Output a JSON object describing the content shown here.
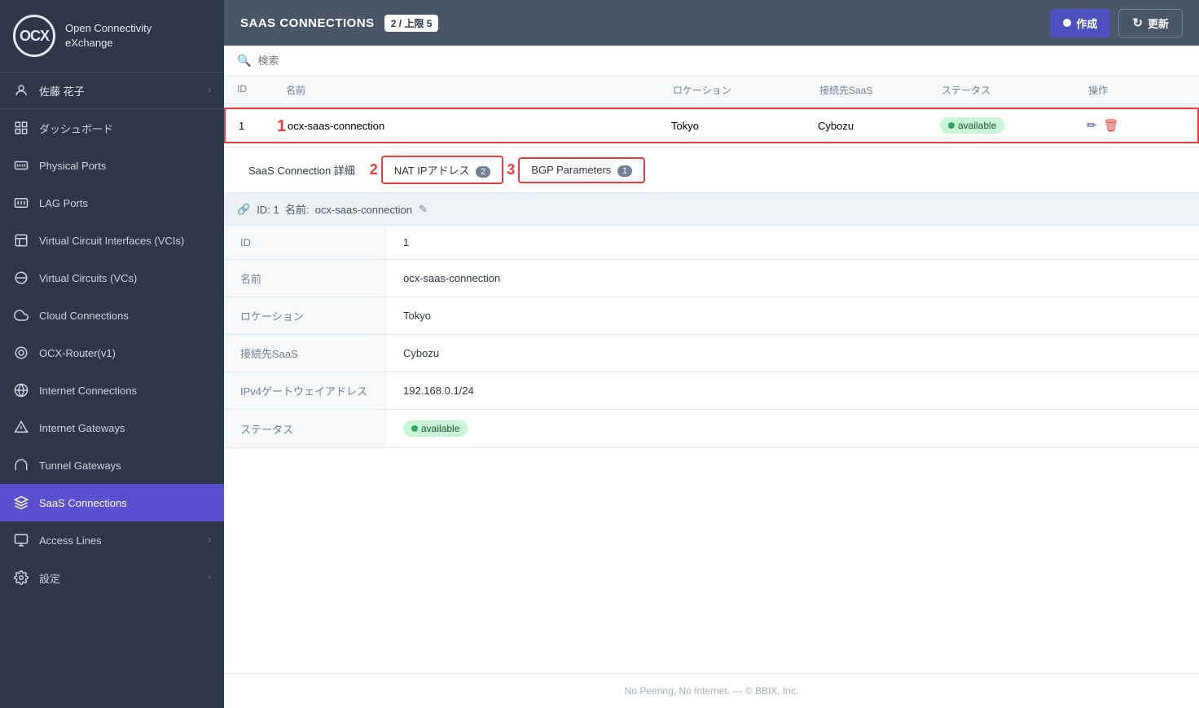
{
  "sidebar": {
    "logo_text": "Open Connectivity\neXchange",
    "user_name": "佐藤 花子",
    "items": [
      {
        "id": "dashboard",
        "label": "ダッシュボード",
        "icon": "home",
        "has_chevron": false,
        "active": false
      },
      {
        "id": "physical-ports",
        "label": "Physical Ports",
        "icon": "ports",
        "has_chevron": false,
        "active": false
      },
      {
        "id": "lag-ports",
        "label": "LAG Ports",
        "icon": "lag",
        "has_chevron": false,
        "active": false
      },
      {
        "id": "vci",
        "label": "Virtual Circuit Interfaces (VCIs)",
        "icon": "vci",
        "has_chevron": false,
        "active": false
      },
      {
        "id": "vc",
        "label": "Virtual Circuits (VCs)",
        "icon": "vc",
        "has_chevron": false,
        "active": false
      },
      {
        "id": "cloud",
        "label": "Cloud Connections",
        "icon": "cloud",
        "has_chevron": false,
        "active": false
      },
      {
        "id": "ocx-router",
        "label": "OCX-Router(v1)",
        "icon": "router",
        "has_chevron": false,
        "active": false
      },
      {
        "id": "internet-connections",
        "label": "Internet Connections",
        "icon": "inet",
        "has_chevron": false,
        "active": false
      },
      {
        "id": "internet-gateways",
        "label": "Internet Gateways",
        "icon": "gateway",
        "has_chevron": false,
        "active": false
      },
      {
        "id": "tunnel-gateways",
        "label": "Tunnel Gateways",
        "icon": "tunnel",
        "has_chevron": false,
        "active": false
      },
      {
        "id": "saas-connections",
        "label": "SaaS Connections",
        "icon": "saas",
        "has_chevron": false,
        "active": true
      },
      {
        "id": "access-lines",
        "label": "Access Lines",
        "icon": "access",
        "has_chevron": true,
        "active": false
      },
      {
        "id": "settings",
        "label": "設定",
        "icon": "settings",
        "has_chevron": true,
        "active": false
      }
    ]
  },
  "topbar": {
    "title": "SAAS CONNECTIONS",
    "badge": "2 / 上限 5",
    "create_btn": "作成",
    "refresh_btn": "更新"
  },
  "search": {
    "placeholder": "検索"
  },
  "table": {
    "headers": [
      "ID",
      "名前",
      "ロケーション",
      "接続先SaaS",
      "ステータス",
      "操作"
    ],
    "rows": [
      {
        "id": "1",
        "name": "ocx-saas-connection",
        "location": "Tokyo",
        "saas": "Cybozu",
        "status": "available"
      }
    ]
  },
  "detail": {
    "tabs": [
      {
        "id": "detail",
        "label": "SaaS Connection 詳細",
        "count": null,
        "active": true,
        "outlined": false
      },
      {
        "id": "nat-ip",
        "label": "NAT IPアドレス",
        "count": "2",
        "active": false,
        "outlined": true
      },
      {
        "id": "bgp",
        "label": "BGP Parameters",
        "count": "1",
        "active": false,
        "outlined": true
      }
    ],
    "id_bar": "ID: 1  名前:  ocx-saas-connection",
    "fields": [
      {
        "label": "ID",
        "value": "1"
      },
      {
        "label": "名前",
        "value": "ocx-saas-connection"
      },
      {
        "label": "ロケーション",
        "value": "Tokyo"
      },
      {
        "label": "接続先SaaS",
        "value": "Cybozu"
      },
      {
        "label": "IPv4ゲートウェイアドレス",
        "value": "192.168.0.1/24"
      },
      {
        "label": "ステータス",
        "value": "available"
      }
    ]
  },
  "footer": {
    "text": "No Peering, No Internet. --- © BBIX, Inc."
  },
  "annotations": {
    "row_number": "1",
    "nat_tab_number": "2",
    "bgp_tab_number": "3"
  }
}
